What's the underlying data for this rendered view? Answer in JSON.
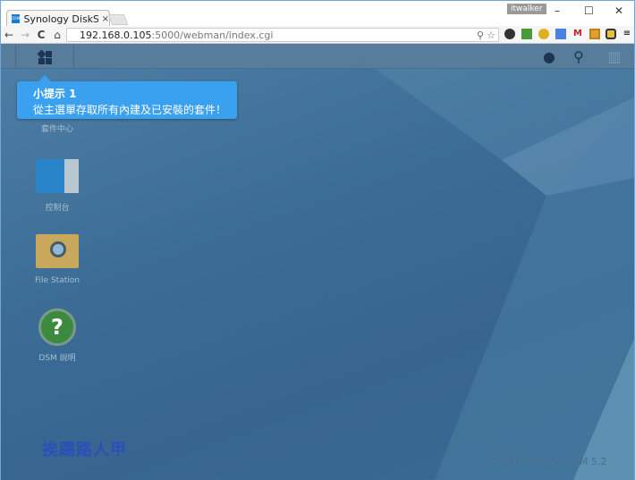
{
  "browser": {
    "tab_title": "Synology DiskStation",
    "tab_close": "×",
    "favicon": "DSM",
    "user": "itwalker",
    "minimize": "–",
    "maximize": "☐",
    "close": "✕",
    "back": "←",
    "forward": "→",
    "reload": "C",
    "home": "⌂",
    "url_host": "192.168.0.105",
    "url_path": ":5000/webman/index.cgi",
    "menu": "≡"
  },
  "tooltip": {
    "title": "小提示 1",
    "body": "從主選單存取所有內建及已安裝的套件！"
  },
  "desktop": {
    "icons": [
      {
        "label": "套件中心"
      },
      {
        "label": "控制台"
      },
      {
        "label": "File Station"
      },
      {
        "label": "DSM 說明"
      }
    ]
  },
  "watermark": "挨踢路人甲",
  "branding": {
    "name": "Synology",
    "product": "DSM 5.2"
  },
  "colors": {
    "desktop": "#3c6d96",
    "tooltip": "#3aa0f0",
    "taskbar": "#5a7d9b"
  }
}
